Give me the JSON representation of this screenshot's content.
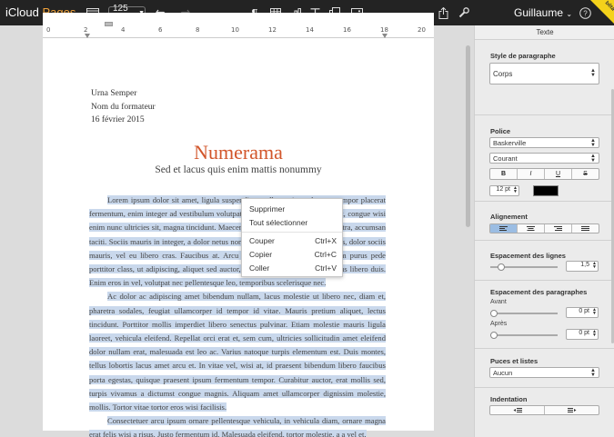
{
  "toolbar": {
    "brand_icloud": "iCloud",
    "brand_pages": "Pages",
    "zoom": "125 %",
    "user": "Guillaume",
    "beta": "bêta",
    "icons": [
      "view-icon",
      "undo-icon",
      "redo-icon",
      "pilcrow-icon",
      "table-icon",
      "chart-icon",
      "text-icon",
      "shape-icon",
      "image-icon",
      "share-icon",
      "wrench-icon",
      "help-icon"
    ]
  },
  "ruler": {
    "numbers": [
      "0",
      "2",
      "4",
      "6",
      "8",
      "10",
      "12",
      "14",
      "16",
      "18",
      "20"
    ]
  },
  "document": {
    "address": [
      "Urna Semper",
      "Nom du formateur",
      "16 février 2015"
    ],
    "title": "Numerama",
    "subtitle": "Sed et lacus quis enim mattis nonummy",
    "paragraphs": [
      "Lorem ipsum dolor sit amet, ligula suspendisse nulla pretium, rhoncus tempor placerat fermentum, enim integer ad vestibulum volutpat. Nisl rhoncus turpis est, vel elit, congue wisi enim nunc ultricies sit, magna tincidunt. Maecenas aliquam maecenas ligula nostra, accumsan taciti. Sociis mauris in integer, a dolor netus non dui aliquet, sagittis felis sodales, dolor sociis mauris, vel eu libero cras. Faucibus at. Arcu habitasse elementum est, ipsum purus pede porttitor class, ut adipiscing, aliquet sed auctor, imperdiet arcu per diam dapibus libero duis. Enim eros in vel, volutpat nec pellentesque leo, temporibus scelerisque nec.",
      "Ac dolor ac adipiscing amet bibendum nullam, lacus molestie ut libero nec, diam et, pharetra sodales, feugiat ullamcorper id tempor id vitae. Mauris pretium aliquet, lectus tincidunt. Porttitor mollis imperdiet libero senectus pulvinar. Etiam molestie mauris ligula laoreet, vehicula eleifend. Repellat orci erat et, sem cum, ultricies sollicitudin amet eleifend dolor nullam erat, malesuada est leo ac. Varius natoque turpis elementum est. Duis montes, tellus lobortis lacus amet arcu et. In vitae vel, wisi at, id praesent bibendum libero faucibus porta egestas, quisque praesent ipsum fermentum tempor. Curabitur auctor, erat mollis sed, turpis vivamus a dictumst congue magnis. Aliquam amet ullamcorper dignissim molestie, mollis. Tortor vitae tortor eros wisi facilisis.",
      "Consectetuer arcu ipsum ornare pellentesque vehicula, in vehicula diam, ornare magna erat felis wisi a risus. Justo fermentum id. Malesuada eleifend, tortor molestie, a a vel et."
    ]
  },
  "context_menu": {
    "items": [
      {
        "label": "Supprimer",
        "shortcut": ""
      },
      {
        "label": "Tout sélectionner",
        "shortcut": ""
      },
      {
        "label": "Couper",
        "shortcut": "Ctrl+X"
      },
      {
        "label": "Copier",
        "shortcut": "Ctrl+C"
      },
      {
        "label": "Coller",
        "shortcut": "Ctrl+V"
      }
    ]
  },
  "panel": {
    "header": "Texte",
    "paragraph_style": {
      "title": "Style de paragraphe",
      "value": "Corps"
    },
    "font": {
      "title": "Police",
      "family": "Baskerville",
      "weight": "Courant",
      "styles": [
        "B",
        "I",
        "U",
        "S"
      ],
      "size": "12 pt",
      "color": "#000000"
    },
    "alignment": {
      "title": "Alignement",
      "active_index": 0
    },
    "line_spacing": {
      "title": "Espacement des lignes",
      "value": "1,5",
      "level": 0.12
    },
    "paragraph_spacing": {
      "title": "Espacement des paragraphes",
      "before_label": "Avant",
      "before_value": "0 pt",
      "after_label": "Après",
      "after_value": "0 pt"
    },
    "bullets": {
      "title": "Puces et listes",
      "value": "Aucun"
    },
    "indentation": {
      "title": "Indentation"
    }
  }
}
